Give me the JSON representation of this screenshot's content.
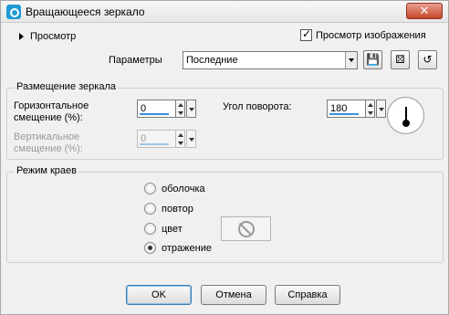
{
  "window": {
    "title": "Вращающееся зеркало",
    "close_glyph": "✕"
  },
  "preview": {
    "toggle_label": "Просмотр",
    "image_preview_label": "Просмотр изображения",
    "image_preview_checked": true
  },
  "params": {
    "label": "Параметры",
    "preset_value": "Последние"
  },
  "mirror_group": {
    "title": "Размещение зеркала",
    "h_offset_label_line1": "Горизонтальное",
    "h_offset_label_line2": "смещение (%):",
    "h_offset_value": "0",
    "v_offset_label_line1": "Вертикальное",
    "v_offset_label_line2": "смещение (%):",
    "v_offset_value": "0",
    "angle_label": "Угол поворота:",
    "angle_value": "180"
  },
  "edge_group": {
    "title": "Режим краев",
    "options": [
      {
        "label": "оболочка",
        "selected": false
      },
      {
        "label": "повтор",
        "selected": false
      },
      {
        "label": "цвет",
        "selected": false
      },
      {
        "label": "отражение",
        "selected": true
      }
    ]
  },
  "buttons": {
    "ok": "OK",
    "cancel": "Отмена",
    "help": "Справка"
  },
  "icons": {
    "app": "mirror-app-icon",
    "save_preset": "save-icon",
    "randomize": "dice-icon",
    "reset": "reset-icon"
  }
}
